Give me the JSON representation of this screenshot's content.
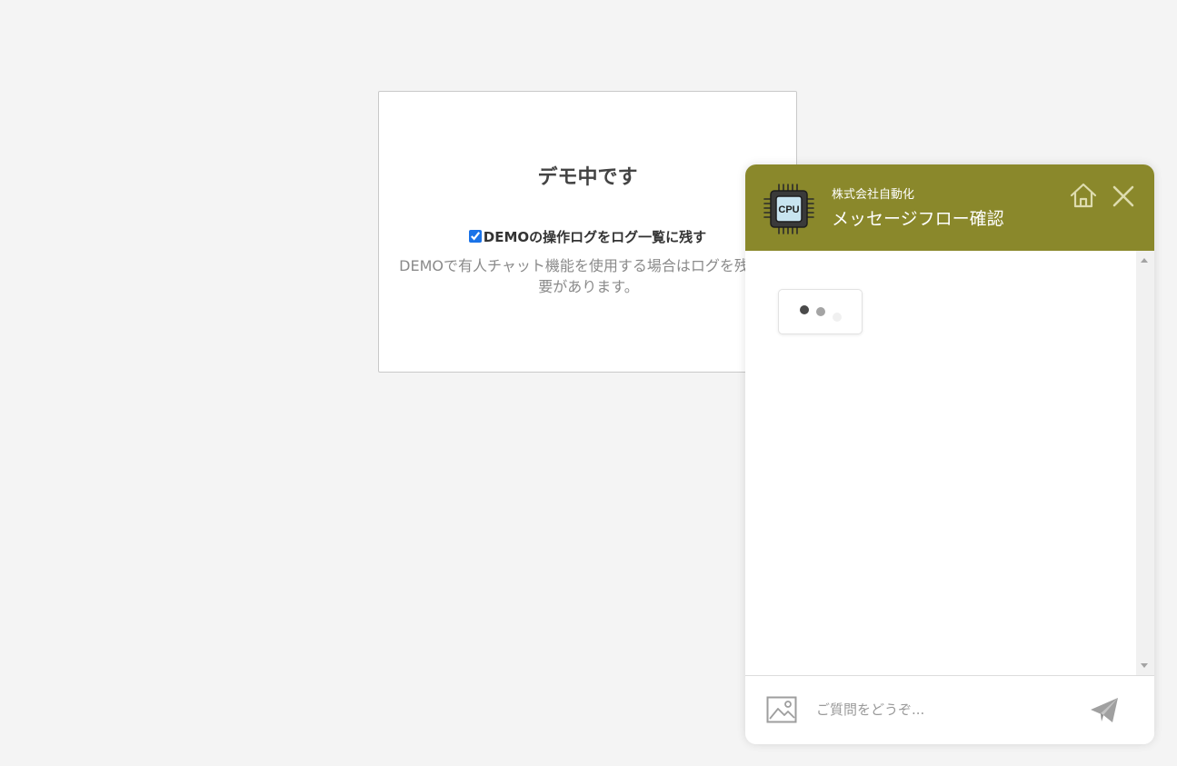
{
  "demo": {
    "title": "デモ中です",
    "checkbox_label": "DEMOの操作ログをログ一覧に残す",
    "checkbox_checked": true,
    "description": "DEMOで有人チャット機能を使用する場合はログを残す必要があります。"
  },
  "chat": {
    "header_color": "#8a882b",
    "company_name": "株式会社自動化",
    "title": "メッセージフロー確認",
    "avatar_icon": "cpu-chip-icon",
    "avatar_text": "CPU",
    "home_icon": "home-icon",
    "close_icon": "close-icon",
    "typing_indicator": "typing-dots",
    "input_placeholder": "ご質問をどうぞ...",
    "image_icon": "image-icon",
    "send_icon": "paper-plane-icon"
  }
}
